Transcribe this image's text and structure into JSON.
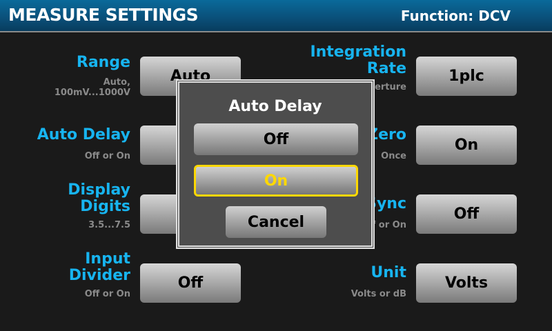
{
  "header": {
    "title": "MEASURE SETTINGS",
    "function": "Function: DCV"
  },
  "left": [
    {
      "label": "Range",
      "sub": "Auto,\n100mV...1000V",
      "value": "Auto"
    },
    {
      "label": "Auto Delay",
      "sub": "Off or On",
      "value": ""
    },
    {
      "label": "Display\nDigits",
      "sub": "3.5...7.5",
      "value": ""
    },
    {
      "label": "Input\nDivider",
      "sub": "Off or On",
      "value": "Off"
    }
  ],
  "right": [
    {
      "label": "Integration\nRate",
      "sub": "Aperture",
      "value": "1plc"
    },
    {
      "label": "Auto Zero",
      "sub": "Once",
      "value": "On"
    },
    {
      "label": "Line Sync",
      "sub": "Off or On",
      "value": "Off"
    },
    {
      "label": "Unit",
      "sub": "Volts or dB",
      "value": "Volts"
    }
  ],
  "dialog": {
    "title": "Auto Delay",
    "options": [
      "Off",
      "On"
    ],
    "cancel": "Cancel",
    "selected": "On"
  },
  "colors": {
    "accent": "#17b4f0",
    "highlight": "#ffd800"
  }
}
